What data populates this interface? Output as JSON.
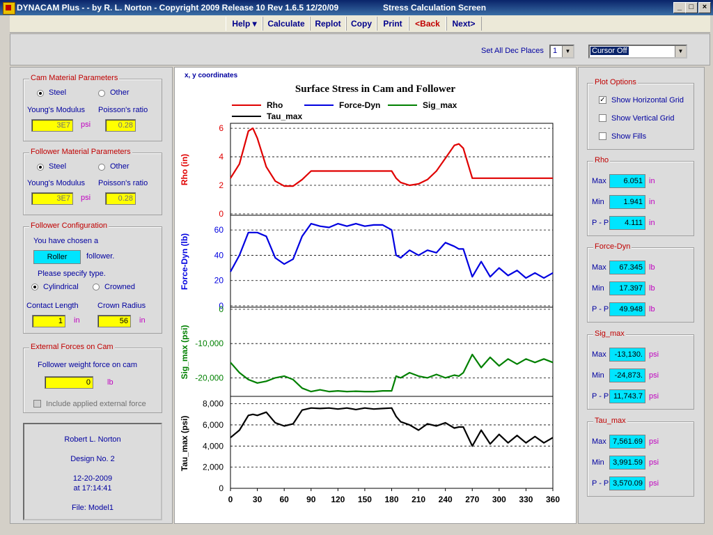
{
  "window": {
    "title": "DYNACAM Plus -  - by R. L. Norton - Copyright 2009 Release 10  Rev 1.6.5  12/20/09",
    "screen_title": "Stress Calculation Screen",
    "min_label": "_",
    "max_label": "□",
    "close_label": "×"
  },
  "menu": [
    {
      "label": "Help ▾",
      "name": "help"
    },
    {
      "label": "Calculate",
      "name": "calculate"
    },
    {
      "label": "Replot",
      "name": "replot"
    },
    {
      "label": "Copy",
      "name": "copy"
    },
    {
      "label": "Print",
      "name": "print"
    },
    {
      "label": "<Back",
      "name": "back"
    },
    {
      "label": "Next>",
      "name": "next"
    }
  ],
  "top_options": {
    "dec_places_label": "Set All Dec Places",
    "dec_places_value": "1",
    "cursor_value": "Cursor Off"
  },
  "cam_material": {
    "title": "Cam Material Parameters",
    "steel": "Steel",
    "other": "Other",
    "youngs_label": "Young's Modulus",
    "poisson_label": "Poisson's ratio",
    "youngs_value": "3E7",
    "youngs_unit": "psi",
    "poisson_value": "0.28"
  },
  "follower_material": {
    "title": "Follower Material Parameters",
    "steel": "Steel",
    "other": "Other",
    "youngs_label": "Young's Modulus",
    "poisson_label": "Poisson's ratio",
    "youngs_value": "3E7",
    "youngs_unit": "psi",
    "poisson_value": "0.28"
  },
  "follower_config": {
    "title": "Follower Configuration",
    "chosen_text": "You have chosen a",
    "type_value": "Roller",
    "follower_text": "follower.",
    "specify_text": "Please specify type.",
    "cylindrical": "Cylindrical",
    "crowned": "Crowned",
    "contact_length_label": "Contact Length",
    "crown_radius_label": "Crown Radius",
    "contact_length_value": "1",
    "contact_length_unit": "in",
    "crown_radius_value": "56",
    "crown_radius_unit": "in"
  },
  "external_forces": {
    "title": "External Forces on Cam",
    "weight_label": "Follower weight force on cam",
    "weight_value": "0",
    "weight_unit": "lb",
    "include_label": "Include applied external force"
  },
  "info": {
    "author": "Robert L. Norton",
    "design": "Design No. 2",
    "date": "12-20-2009",
    "time": "at 17:14:41",
    "file": "File: Model1"
  },
  "plot_options": {
    "title": "Plot Options",
    "horizontal_grid": "Show Horizontal Grid",
    "vertical_grid": "Show Vertical Grid",
    "fills": "Show Fills",
    "horizontal_checked": "✓",
    "vertical_checked": "",
    "fills_checked": ""
  },
  "stats": [
    {
      "title": "Rho",
      "max": "6.051",
      "min": "1.941",
      "pp": "4.111",
      "unit": "in"
    },
    {
      "title": "Force-Dyn",
      "max": "67.345",
      "min": "17.397",
      "pp": "49.948",
      "unit": "lb"
    },
    {
      "title": "Sig_max",
      "max": "-13,130.",
      "min": "-24,873.",
      "pp": "11,743.7",
      "unit": "psi"
    },
    {
      "title": "Tau_max",
      "max": "7,561.69",
      "min": "3,991.59",
      "pp": "3,570.09",
      "unit": "psi"
    }
  ],
  "stat_labels": {
    "max": "Max",
    "min": "Min",
    "pp": "P - P"
  },
  "chart_data": {
    "type": "line",
    "title": "Surface Stress in Cam and Follower",
    "corner_label": "x, y  coordinates",
    "x": [
      0,
      10,
      20,
      25,
      30,
      40,
      50,
      60,
      70,
      80,
      90,
      100,
      110,
      120,
      130,
      140,
      150,
      160,
      170,
      180,
      185,
      190,
      200,
      210,
      220,
      230,
      240,
      250,
      255,
      260,
      270,
      280,
      290,
      300,
      310,
      320,
      330,
      340,
      350,
      360
    ],
    "xticks": [
      "0",
      "30",
      "60",
      "90",
      "120",
      "150",
      "180",
      "210",
      "240",
      "270",
      "300",
      "330",
      "360"
    ],
    "xlim": [
      0,
      360
    ],
    "grid": "horizontal",
    "legend": [
      "Rho",
      "Force-Dyn",
      "Sig_max",
      "Tau_max"
    ],
    "series": [
      {
        "name": "Rho",
        "ylabel": "Rho  (in)",
        "color": "#e00000",
        "yticks": [
          "0",
          "2",
          "4",
          "6"
        ],
        "ylim": [
          0,
          6.2
        ],
        "values": [
          2.5,
          3.5,
          5.8,
          6.0,
          5.3,
          3.3,
          2.3,
          1.95,
          1.95,
          2.4,
          3.0,
          3.0,
          3.0,
          3.0,
          3.0,
          3.0,
          3.0,
          3.0,
          3.0,
          3.0,
          2.5,
          2.2,
          2.0,
          2.1,
          2.4,
          3.0,
          3.9,
          4.8,
          4.9,
          4.6,
          2.5,
          2.5,
          2.5,
          2.5,
          2.5,
          2.5,
          2.5,
          2.5,
          2.5,
          2.5
        ]
      },
      {
        "name": "Force-Dyn",
        "ylabel": "Force-Dyn  (lb)",
        "color": "#0000e0",
        "yticks": [
          "0",
          "20",
          "40",
          "60"
        ],
        "ylim": [
          0,
          70
        ],
        "values": [
          27,
          40,
          58,
          58,
          58,
          55,
          38,
          33,
          37,
          55,
          65,
          63,
          62,
          65,
          63,
          65,
          63,
          64,
          64,
          60,
          40,
          38,
          44,
          40,
          44,
          42,
          50,
          47,
          45,
          45,
          23,
          35,
          23,
          30,
          24,
          28,
          22,
          26,
          22,
          26
        ]
      },
      {
        "name": "Sig_max",
        "ylabel": "Sig_max  (psi)",
        "color": "#008000",
        "yticks": [
          "0",
          "-10,000",
          "-20,000"
        ],
        "ylim": [
          -25000,
          0
        ],
        "values": [
          -15500,
          -18500,
          -20500,
          -21000,
          -21500,
          -21000,
          -20000,
          -19500,
          -20500,
          -23000,
          -24000,
          -23500,
          -24000,
          -23800,
          -24000,
          -23900,
          -24000,
          -24000,
          -23800,
          -23800,
          -19500,
          -20000,
          -18500,
          -19500,
          -20000,
          -19000,
          -20000,
          -19200,
          -19500,
          -18500,
          -13200,
          -17000,
          -14000,
          -16500,
          -14500,
          -16000,
          -14500,
          -15500,
          -14500,
          -15500
        ]
      },
      {
        "name": "Tau_max",
        "ylabel": "Tau_max  (psi)",
        "color": "#000000",
        "yticks": [
          "0",
          "2,000",
          "4,000",
          "6,000",
          "8,000"
        ],
        "ylim": [
          0,
          8500
        ],
        "values": [
          4800,
          5500,
          6900,
          7000,
          6900,
          7200,
          6200,
          5900,
          6100,
          7400,
          7600,
          7550,
          7600,
          7500,
          7600,
          7450,
          7600,
          7500,
          7550,
          7600,
          6800,
          6300,
          6000,
          5500,
          6100,
          5900,
          6200,
          5700,
          5800,
          5800,
          4000,
          5500,
          4200,
          5100,
          4300,
          5000,
          4300,
          4900,
          4300,
          4800
        ]
      }
    ]
  }
}
